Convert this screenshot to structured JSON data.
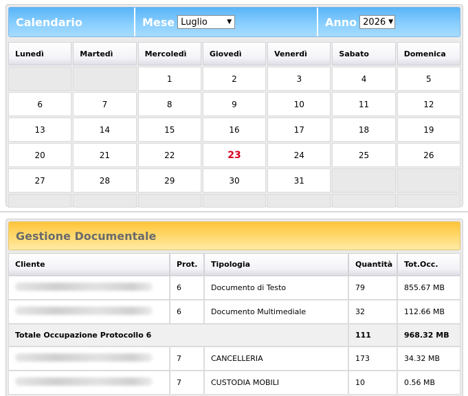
{
  "calendar": {
    "title": "Calendario",
    "month_label": "Mese",
    "month_value": "Luglio",
    "year_label": "Anno",
    "year_value": "2026",
    "today": "23",
    "day_names": [
      "Lunedì",
      "Martedì",
      "Mercoledì",
      "Giovedì",
      "Venerdì",
      "Sabato",
      "Domenica"
    ],
    "weeks": [
      [
        "",
        "",
        "1",
        "2",
        "3",
        "4",
        "5"
      ],
      [
        "6",
        "7",
        "8",
        "9",
        "10",
        "11",
        "12"
      ],
      [
        "13",
        "14",
        "15",
        "16",
        "17",
        "18",
        "19"
      ],
      [
        "20",
        "21",
        "22",
        "23",
        "24",
        "25",
        "26"
      ],
      [
        "27",
        "28",
        "29",
        "30",
        "31",
        "",
        ""
      ],
      [
        "",
        "",
        "",
        "",
        "",
        "",
        ""
      ]
    ]
  },
  "documents": {
    "title": "Gestione Documentale",
    "columns": [
      "Cliente",
      "Prot.",
      "Tipologia",
      "Quantità",
      "Tot.Occ."
    ],
    "rows": [
      {
        "type": "item",
        "client": "",
        "prot": "6",
        "tipologia": "Documento di Testo",
        "quantita": "79",
        "tot": "855.67 MB"
      },
      {
        "type": "item",
        "client": "",
        "prot": "6",
        "tipologia": "Documento Multimediale",
        "quantita": "32",
        "tot": "112.66 MB"
      },
      {
        "type": "total",
        "label": "Totale Occupazione Protocollo 6",
        "quantita": "111",
        "tot": "968.32 MB"
      },
      {
        "type": "item",
        "client": "",
        "prot": "7",
        "tipologia": "CANCELLERIA",
        "quantita": "173",
        "tot": "34.32 MB"
      },
      {
        "type": "item",
        "client": "",
        "prot": "7",
        "tipologia": "CUSTODIA MOBILI",
        "quantita": "10",
        "tot": "0.56 MB"
      }
    ]
  },
  "colors": {
    "calendar_header": "#7cc6fd",
    "documents_header": "#ffd35a",
    "today_text": "#d6001c"
  }
}
